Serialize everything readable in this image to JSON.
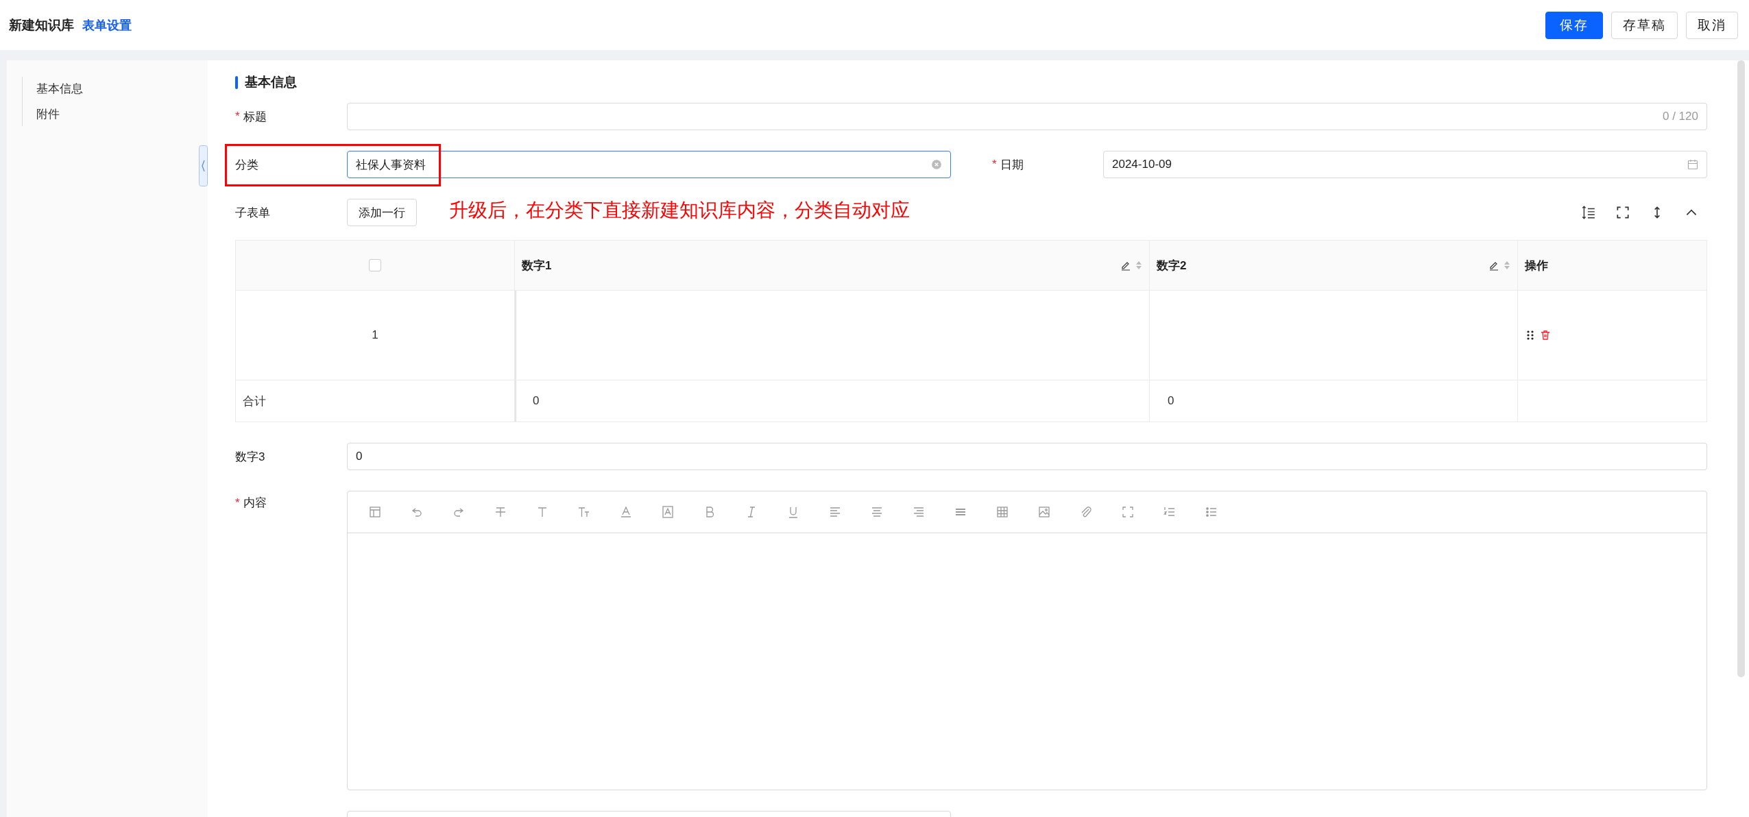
{
  "header": {
    "title": "新建知识库",
    "link": "表单设置",
    "buttons": [
      {
        "label": "保存",
        "kind": "primary"
      },
      {
        "label": "存草稿",
        "kind": "default"
      },
      {
        "label": "取消",
        "kind": "default"
      }
    ]
  },
  "sidebar": {
    "items": [
      {
        "label": "基本信息"
      },
      {
        "label": "附件"
      }
    ]
  },
  "section_title": "基本信息",
  "title_field": {
    "required_mark": "*",
    "label": "标题",
    "counter": "0 / 120"
  },
  "category_field": {
    "label": "分类",
    "value": "社保人事资料",
    "focused": true
  },
  "date_field": {
    "required_mark": "*",
    "label": "日期",
    "value": "2024-10-09"
  },
  "annotation": "升级后，在分类下直接新建知识库内容，分类自动对应",
  "subform": {
    "label": "子表单",
    "add_button": "添加一行",
    "select_all_checked": false,
    "columns": [
      {
        "label": "数字1",
        "editable": true
      },
      {
        "label": "数字2",
        "editable": true
      },
      {
        "label": "操作",
        "editable": false
      }
    ],
    "rows": [
      {
        "index": "1"
      }
    ],
    "totals": {
      "label": "合计",
      "values": [
        "0",
        "0"
      ]
    }
  },
  "number3_field": {
    "label": "数字3",
    "value": "0"
  },
  "content_field": {
    "required_mark": "*",
    "label": "内容"
  }
}
